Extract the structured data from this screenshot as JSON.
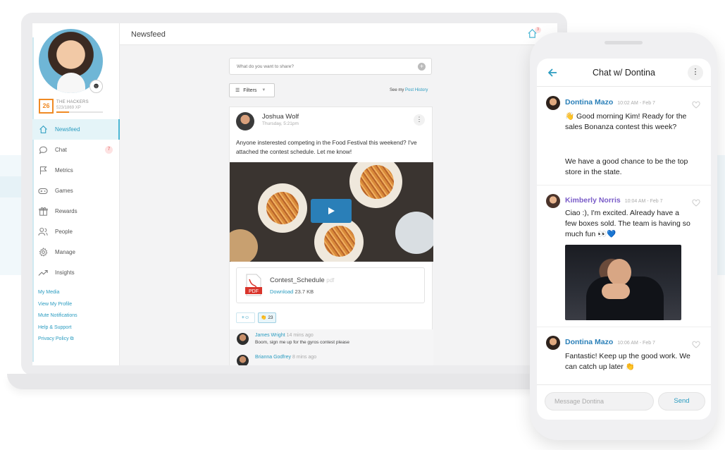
{
  "profile": {
    "level": "26",
    "team": "THE HACKERS",
    "xp": "523/1869 XP",
    "xp_fraction": 0.28
  },
  "sidebar": {
    "items": [
      {
        "label": "Newsfeed",
        "icon": "home-icon"
      },
      {
        "label": "Chat",
        "icon": "chat-icon",
        "count": "7"
      },
      {
        "label": "Metrics",
        "icon": "flag-icon"
      },
      {
        "label": "Games",
        "icon": "gamepad-icon"
      },
      {
        "label": "Rewards",
        "icon": "gift-icon"
      },
      {
        "label": "People",
        "icon": "people-icon"
      },
      {
        "label": "Manage",
        "icon": "gear-icon"
      },
      {
        "label": "Insights",
        "icon": "trend-icon"
      }
    ],
    "links": [
      "My Media",
      "View My Profile",
      "Mute Notifications",
      "Help & Support",
      "Privacy Policy"
    ]
  },
  "header": {
    "title": "Newsfeed",
    "home_badge": "3"
  },
  "composer": {
    "placeholder": "What do you want to share?"
  },
  "filters": {
    "label": "Filters",
    "see_prefix": "See my",
    "see_link": "Post History"
  },
  "post": {
    "author": "Joshua Wolf",
    "time": "Thursday, 5:21pm",
    "text": "Anyone insterested competing in the Food Festival this weekend? I've attached the contest schedule. Let me know!",
    "attachment": {
      "name": "Contest_Schedule",
      "ext": "pdf",
      "download": "Download",
      "size": "23.7 KB"
    },
    "reaction_add": "+☺",
    "reaction_count": "👏 23",
    "comments": [
      {
        "name": "James Wright",
        "time": "14 mins ago",
        "text": "Boom, sign me up for the gyros contest please"
      },
      {
        "name": "Brianna Godfrey",
        "time": "8 mins ago",
        "text": ""
      }
    ]
  },
  "chat": {
    "title": "Chat w/ Dontina",
    "messages": [
      {
        "name": "Dontina Mazo",
        "time": "10:02 AM - Feb 7",
        "color": "#2a7fb8",
        "text": "👋 Good morning Kim! Ready for the sales Bonanza contest this week?",
        "text2": "We have a good chance to be the top store in the state."
      },
      {
        "name": "Kimberly Norris",
        "time": "10:04 AM - Feb 7",
        "color": "#7a5cc8",
        "text": "Ciao :), I'm excited. Already have a few boxes sold. The team is having so much fun 👀💙"
      },
      {
        "name": "Dontina Mazo",
        "time": "10:06 AM - Feb 7",
        "color": "#2a7fb8",
        "text": "Fantastic! Keep up the good work. We can catch up later 👏"
      }
    ],
    "input_placeholder": "Message Dontina",
    "send": "Send"
  },
  "colors": {
    "accent": "#2a9cc0",
    "level": "#f08a24",
    "badge": "#e05454"
  }
}
